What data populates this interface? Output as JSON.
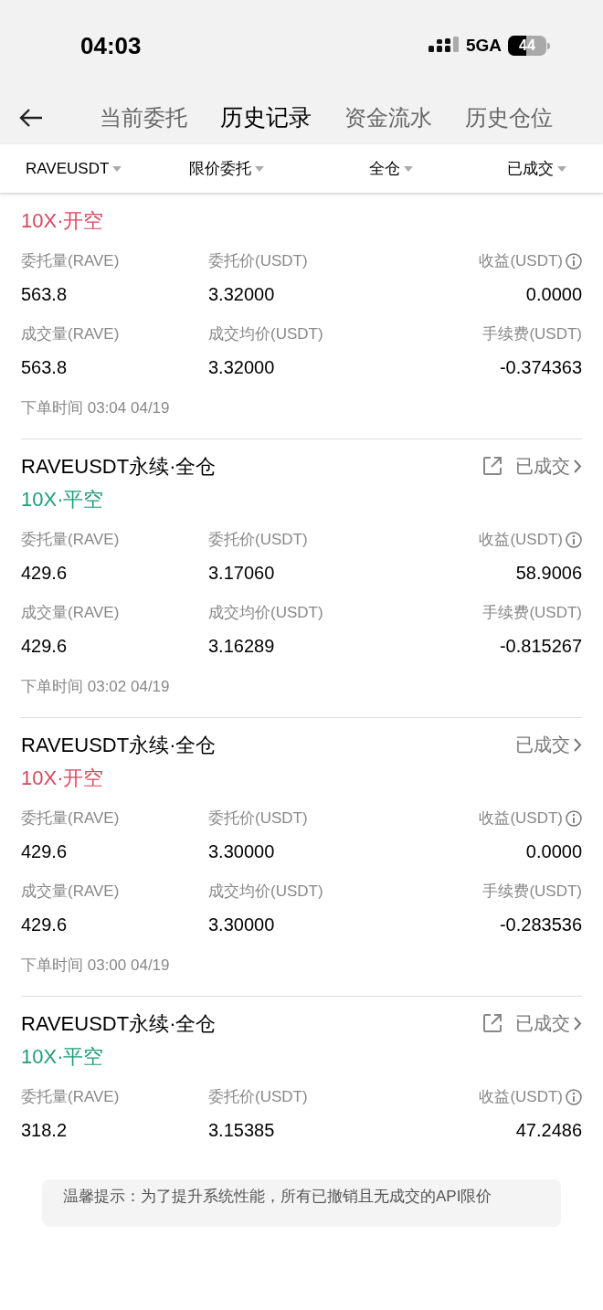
{
  "status_bar": {
    "time": "04:03",
    "network": "5GA",
    "battery": "44"
  },
  "tabs": [
    {
      "label": "当前委托",
      "selected": false
    },
    {
      "label": "历史记录",
      "selected": true
    },
    {
      "label": "资金流水",
      "selected": false
    },
    {
      "label": "历史仓位",
      "selected": false
    }
  ],
  "filters": [
    "RAVEUSDT",
    "限价委托",
    "全仓",
    "已成交"
  ],
  "orders": [
    {
      "leverage": "10X·开空",
      "color": "#d9485f",
      "rows": [
        [
          {
            "label": "委托量(RAVE)",
            "value": "563.8",
            "info": false
          },
          {
            "label": "委托价(USDT)",
            "value": "3.32000",
            "info": false
          },
          {
            "label": "收益(USDT)",
            "value": "0.0000",
            "info": true
          }
        ],
        [
          {
            "label": "成交量(RAVE)",
            "value": "563.8",
            "info": false
          },
          {
            "label": "成交均价(USDT)",
            "value": "3.32000",
            "info": false
          },
          {
            "label": "手续费(USDT)",
            "value": "-0.374363",
            "info": false
          }
        ]
      ],
      "time": "下单时间 03:04 04/19"
    },
    {
      "title": "RAVEUSDT永续·全仓",
      "leverage": "10X·平空",
      "color": "#1f9d7a",
      "share_icon": true,
      "status": "已成交",
      "rows": [
        [
          {
            "label": "委托量(RAVE)",
            "value": "429.6",
            "info": false
          },
          {
            "label": "委托价(USDT)",
            "value": "3.17060",
            "info": false
          },
          {
            "label": "收益(USDT)",
            "value": "58.9006",
            "info": true
          }
        ],
        [
          {
            "label": "成交量(RAVE)",
            "value": "429.6",
            "info": false
          },
          {
            "label": "成交均价(USDT)",
            "value": "3.16289",
            "info": false
          },
          {
            "label": "手续费(USDT)",
            "value": "-0.815267",
            "info": false
          }
        ]
      ],
      "time": "下单时间 03:02 04/19"
    },
    {
      "title": "RAVEUSDT永续·全仓",
      "leverage": "10X·开空",
      "color": "#d9485f",
      "share_icon": false,
      "status": "已成交",
      "rows": [
        [
          {
            "label": "委托量(RAVE)",
            "value": "429.6",
            "info": false
          },
          {
            "label": "委托价(USDT)",
            "value": "3.30000",
            "info": false
          },
          {
            "label": "收益(USDT)",
            "value": "0.0000",
            "info": true
          }
        ],
        [
          {
            "label": "成交量(RAVE)",
            "value": "429.6",
            "info": false
          },
          {
            "label": "成交均价(USDT)",
            "value": "3.30000",
            "info": false
          },
          {
            "label": "手续费(USDT)",
            "value": "-0.283536",
            "info": false
          }
        ]
      ],
      "time": "下单时间 03:00 04/19"
    },
    {
      "title": "RAVEUSDT永续·全仓",
      "leverage": "10X·平空",
      "color": "#1f9d7a",
      "share_icon": true,
      "status": "已成交",
      "rows": [
        [
          {
            "label": "委托量(RAVE)",
            "value": "318.2",
            "info": false
          },
          {
            "label": "委托价(USDT)",
            "value": "3.15385",
            "info": false
          },
          {
            "label": "收益(USDT)",
            "value": "47.2486",
            "info": true
          }
        ]
      ]
    }
  ],
  "notice": "温馨提示：为了提升系统性能，所有已撤销且无成交的API限价"
}
